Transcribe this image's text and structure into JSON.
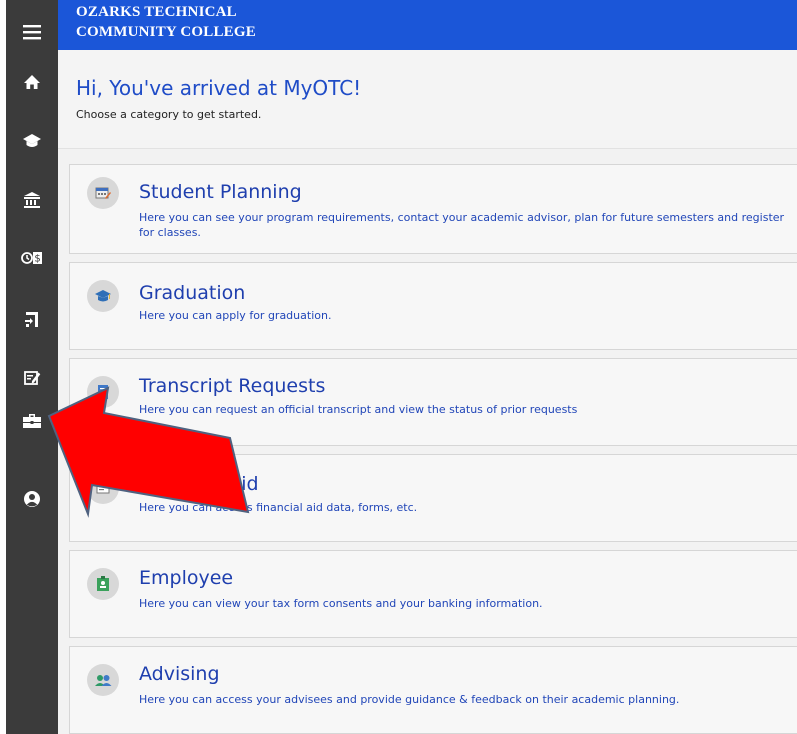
{
  "brand": {
    "line1": "Ozarks Technical",
    "line2": "Community College",
    "header_color": "#1b56d8"
  },
  "sidebar": {
    "background": "#3b3b3b",
    "items": [
      {
        "name": "menu",
        "icon": "hamburger-menu-icon"
      },
      {
        "name": "home",
        "icon": "home-icon"
      },
      {
        "name": "academics",
        "icon": "graduation-cap-icon"
      },
      {
        "name": "finance",
        "icon": "bank-icon"
      },
      {
        "name": "payments",
        "icon": "clock-dollar-icon"
      },
      {
        "name": "exit",
        "icon": "exit-door-icon"
      },
      {
        "name": "forms",
        "icon": "edit-form-icon"
      },
      {
        "name": "employee",
        "icon": "briefcase-icon"
      },
      {
        "name": "profile",
        "icon": "user-circle-icon"
      }
    ]
  },
  "welcome": {
    "title": "Hi, You've arrived at MyOTC!",
    "subtitle": "Choose a category to get started."
  },
  "categories": [
    {
      "title": "Student Planning",
      "description": "Here you can see your program requirements, contact your academic advisor, plan for future semesters and register for classes.",
      "icon": "calendar-planning-icon"
    },
    {
      "title": "Graduation",
      "description": "Here you can apply for graduation.",
      "icon": "graduation-cap-icon"
    },
    {
      "title": "Transcript Requests",
      "description": "Here you can request an official transcript and view the status of prior requests",
      "icon": "transcript-document-icon"
    },
    {
      "title": "Financial Aid",
      "description": "Here you can access financial aid data, forms, etc.",
      "icon": "financial-aid-icon"
    },
    {
      "title": "Employee",
      "description": "Here you can view your tax form consents and your banking information.",
      "icon": "employee-badge-icon"
    },
    {
      "title": "Advising",
      "description": "Here you can access your advisees and provide guidance & feedback on their academic planning.",
      "icon": "advisor-people-icon"
    }
  ],
  "colors": {
    "accent_blue": "#1f3fae",
    "annotation_arrow": "#ff0000",
    "icon_circle": "#d8d8d8"
  }
}
